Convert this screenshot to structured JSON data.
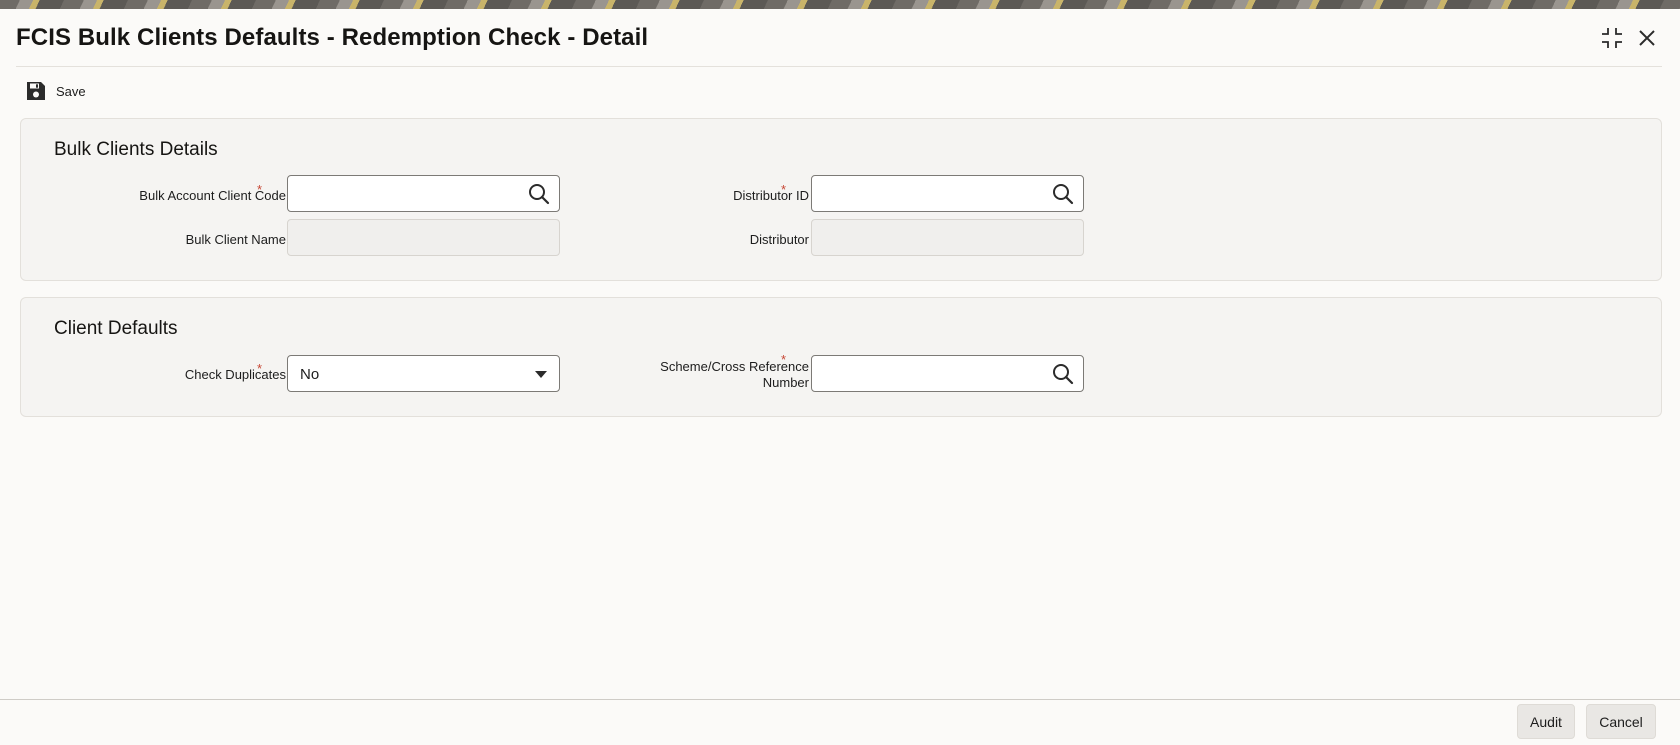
{
  "window": {
    "title": "FCIS Bulk Clients Defaults - Redemption Check - Detail"
  },
  "toolbar": {
    "save_label": "Save"
  },
  "sections": {
    "bulk_clients_details": {
      "title": "Bulk Clients Details",
      "bulk_account_client_code": {
        "label": "Bulk Account Client Code",
        "value": ""
      },
      "distributor_id": {
        "label": "Distributor ID",
        "value": ""
      },
      "bulk_client_name": {
        "label": "Bulk Client Name",
        "value": ""
      },
      "distributor": {
        "label": "Distributor",
        "value": ""
      }
    },
    "client_defaults": {
      "title": "Client Defaults",
      "check_duplicates": {
        "label": "Check Duplicates",
        "value": "No"
      },
      "scheme_cross_reference": {
        "label_line1": "Scheme/Cross Reference",
        "label_line2": "Number",
        "value": ""
      }
    }
  },
  "required_marker": "*",
  "footer": {
    "audit_label": "Audit",
    "cancel_label": "Cancel"
  },
  "colors": {
    "required": "#c74634",
    "panel_bg": "#f5f4f2",
    "input_border": "#7c7a76"
  },
  "icons": {
    "save": "save-icon",
    "search": "search-icon",
    "maximize": "maximize-icon",
    "close": "close-icon",
    "dropdown": "chevron-down-icon"
  }
}
